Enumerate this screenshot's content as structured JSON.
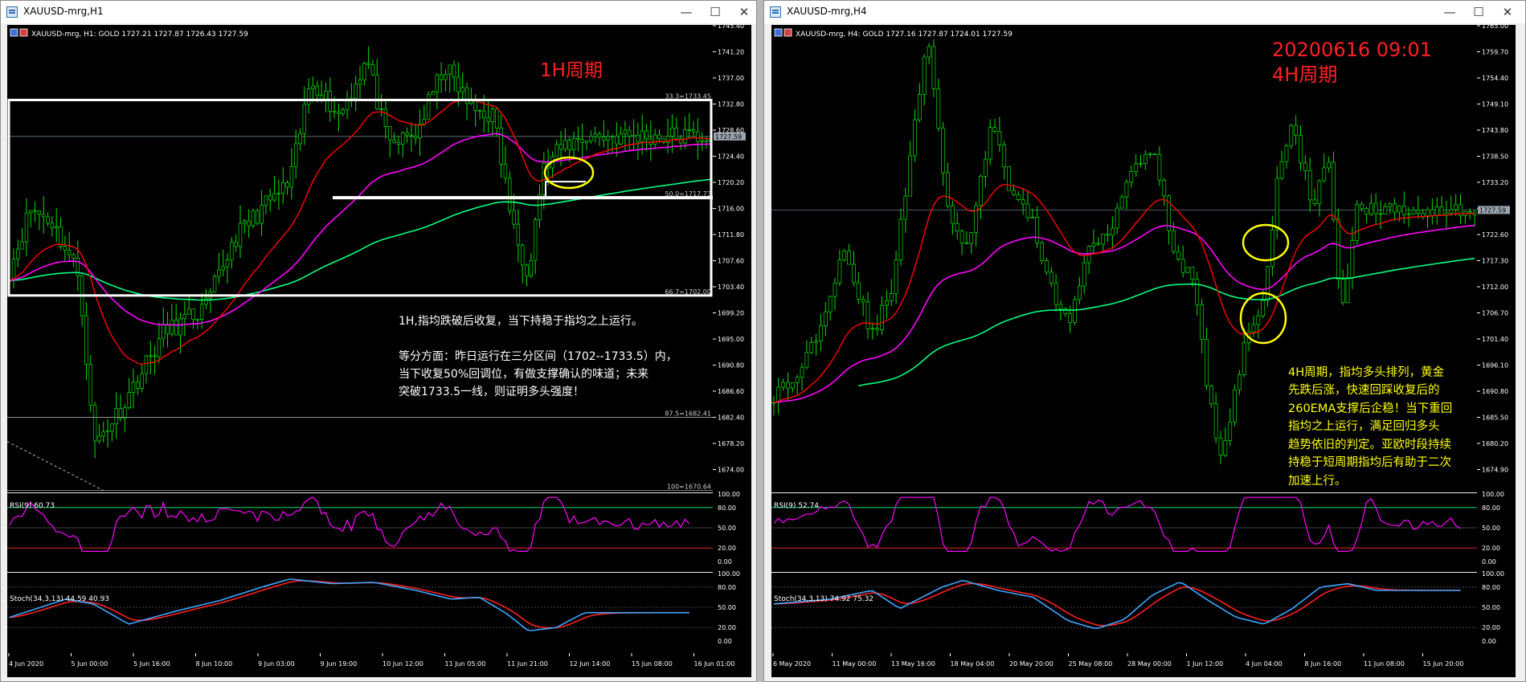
{
  "colors": {
    "chart_bg": "#000000",
    "candle": "#00e000",
    "ema_fast": "#ff0000",
    "ema_mid": "#ff00ff",
    "ema_slow": "#00ff80",
    "rsi_line": "#ff00ff",
    "stoch_main": "#3da5ff",
    "stoch_signal": "#ff2020",
    "annotation_red": "#ff2020",
    "annotation_yellow": "#ffff00",
    "axis_text": "#ffffff"
  },
  "icons": {
    "app": "chart-window-icon",
    "minimize": "minimize-icon",
    "maximize": "maximize-icon",
    "close": "close-icon"
  },
  "left": {
    "window_title": "XAUUSD-mrg,H1",
    "controls": {
      "minimize": "—",
      "maximize": "☐",
      "close": "✕"
    },
    "chart_info": "XAUUSD-mrg, H1:  GOLD   1727.21  1727.87  1726.43  1727.59",
    "period_label": "1H周期",
    "price_axis": [
      "1745.40",
      "1741.20",
      "1737.00",
      "1732.80",
      "1728.60",
      "1724.40",
      "1720.20",
      "1716.00",
      "1711.80",
      "1707.60",
      "1703.40",
      "1699.20",
      "1695.00",
      "1690.80",
      "1686.60",
      "1682.40",
      "1678.20",
      "1674.00"
    ],
    "current_price": "1727.59",
    "fib_levels": [
      "33.3=1733.45",
      "50.0=1717.73",
      "66.7=1702.00",
      "87.5=1682.41",
      "100=1670.64"
    ],
    "note_1": "1H,指均跌破后收复，当下持稳于指均之上运行。",
    "note_2": [
      "等分方面：昨日运行在三分区间（1702--1733.5）内，",
      "当下收复50%回调位，有做支撑确认的味道；未来",
      "突破1733.5一线，则证明多头强度！"
    ],
    "rsi_label": "RSI(9) 60.73",
    "rsi_axis": [
      "100.00",
      "80.00",
      "50.00",
      "20.00",
      "0.00"
    ],
    "stoch_label": "Stoch(34,3,13) 44.59 40.93",
    "stoch_axis": [
      "100.00",
      "80.00",
      "50.00",
      "20.00",
      "0.00"
    ],
    "time_axis": [
      "4 Jun 2020",
      "5 Jun 00:00",
      "5 Jun 16:00",
      "8 Jun 10:00",
      "9 Jun 03:00",
      "9 Jun 19:00",
      "10 Jun 12:00",
      "11 Jun 05:00",
      "11 Jun 21:00",
      "12 Jun 14:00",
      "15 Jun 08:00",
      "16 Jun 01:00"
    ]
  },
  "right": {
    "window_title": "XAUUSD-mrg,H4",
    "controls": {
      "minimize": "—",
      "maximize": "☐",
      "close": "✕"
    },
    "chart_info": "XAUUSD-mrg, H4:  GOLD   1727.16  1727.87  1724.01  1727.59",
    "date_label": "20200616 09:01",
    "period_label": "4H周期",
    "price_axis": [
      "1765.00",
      "1759.70",
      "1754.40",
      "1749.10",
      "1743.80",
      "1738.50",
      "1733.20",
      "1727.90",
      "1722.60",
      "1717.30",
      "1712.00",
      "1706.70",
      "1701.40",
      "1696.10",
      "1690.80",
      "1685.50",
      "1680.20",
      "1674.90"
    ],
    "current_price": "1727.59",
    "note": [
      "4H周期，指均多头排列，黄金",
      "先跌后涨，快速回踩收复后的",
      "260EMA支撑后企稳！当下重回",
      "指均之上运行，满足回归多头",
      "趋势依旧的判定。亚欧时段持续",
      "持稳于短周期指均后有助于二次",
      "加速上行。"
    ],
    "rsi_label": "RSI(9) 52.74",
    "rsi_axis": [
      "100.00",
      "80.00",
      "50.00",
      "20.00",
      "0.00"
    ],
    "stoch_label": "Stoch(34,3,13) 74.92 75.32",
    "stoch_axis": [
      "100.00",
      "80.00",
      "50.00",
      "20.00",
      "0.00"
    ],
    "time_axis": [
      "6 May 2020",
      "11 May 00:00",
      "13 May 16:00",
      "18 May 04:00",
      "20 May 20:00",
      "25 May 08:00",
      "28 May 00:00",
      "1 Jun 12:00",
      "4 Jun 04:00",
      "8 Jun 16:00",
      "11 Jun 08:00",
      "15 Jun 20:00"
    ]
  }
}
